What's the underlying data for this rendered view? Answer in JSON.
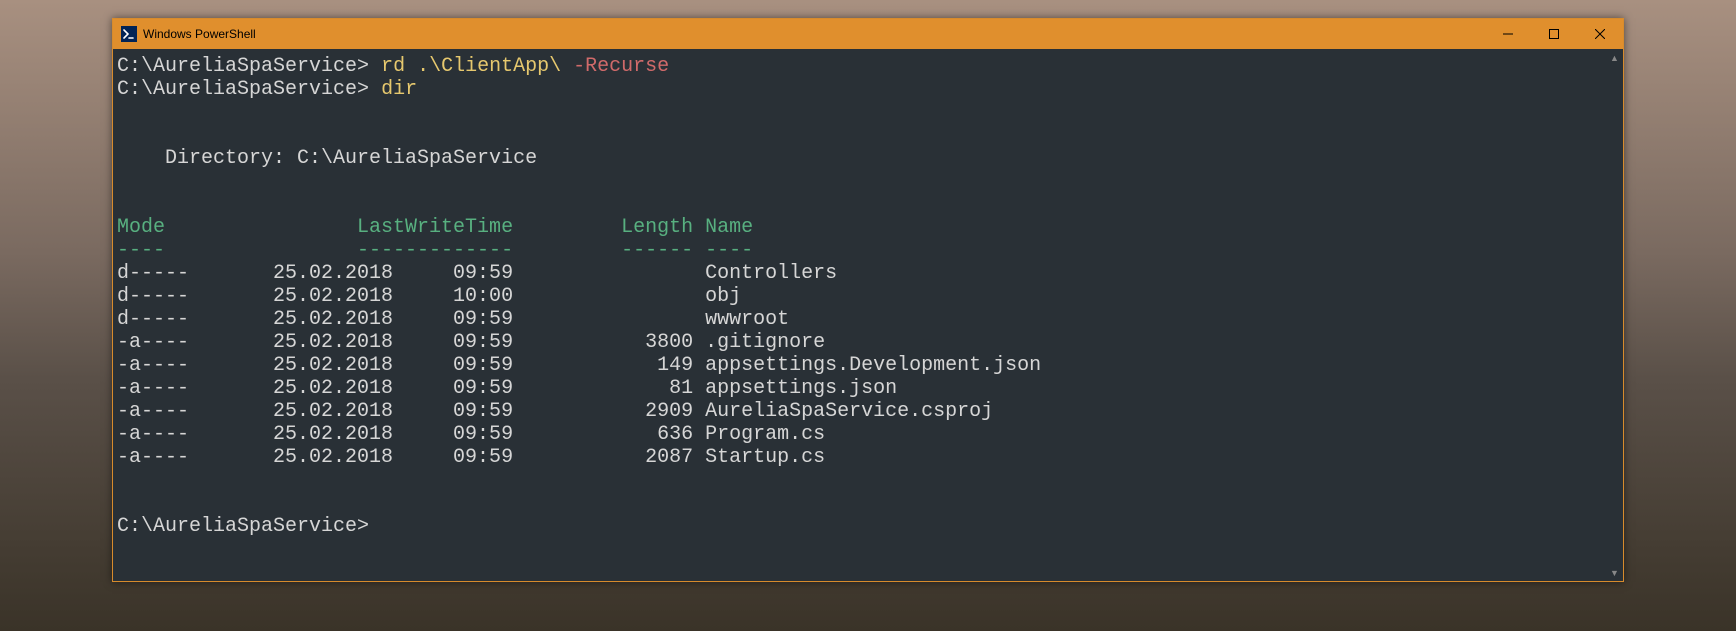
{
  "window": {
    "title": "Windows PowerShell"
  },
  "session": {
    "prompt1": "C:\\AureliaSpaService>",
    "cmd1a": "rd",
    "cmd1b": ".\\ClientApp\\",
    "cmd1c": "-Recurse",
    "prompt2": "C:\\AureliaSpaService>",
    "cmd2": "dir",
    "dir_header": "    Directory: C:\\AureliaSpaService",
    "col_line1": "Mode                LastWriteTime         Length Name",
    "col_line2": "----                -------------         ------ ----",
    "rows": [
      "d-----       25.02.2018     09:59                Controllers",
      "d-----       25.02.2018     10:00                obj",
      "d-----       25.02.2018     09:59                wwwroot",
      "-a----       25.02.2018     09:59           3800 .gitignore",
      "-a----       25.02.2018     09:59            149 appsettings.Development.json",
      "-a----       25.02.2018     09:59             81 appsettings.json",
      "-a----       25.02.2018     09:59           2909 AureliaSpaService.csproj",
      "-a----       25.02.2018     09:59            636 Program.cs",
      "-a----       25.02.2018     09:59           2087 Startup.cs"
    ],
    "prompt3": "C:\\AureliaSpaService>"
  }
}
